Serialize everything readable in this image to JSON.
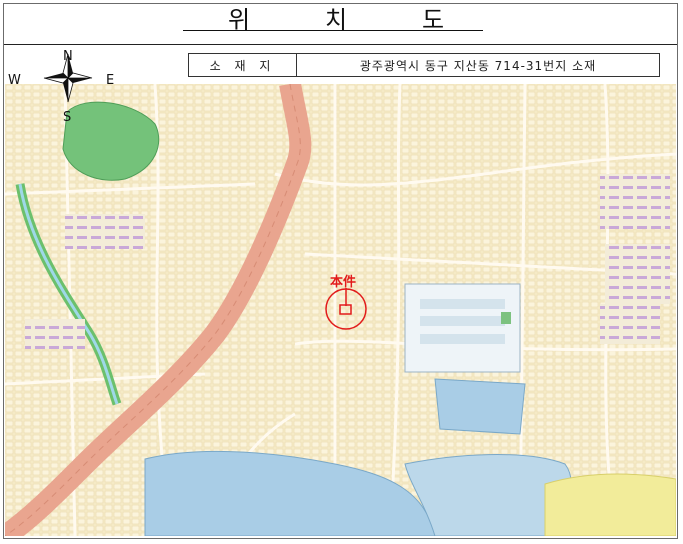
{
  "page": {
    "title_chars": [
      "위",
      "치",
      "도"
    ]
  },
  "location": {
    "label": "소 재 지",
    "address": "광주광역시 동구 지산동 714-31번지 소재"
  },
  "compass": {
    "north": "N",
    "south": "S",
    "east": "E",
    "west": "W"
  },
  "marker": {
    "label": "本件"
  },
  "colors": {
    "road": "#e9a58f",
    "park": "#74c27a",
    "water": "#a9cde6",
    "sand": "#f2ec9a",
    "marker": "#e21b1b",
    "map_bg": "#f6ecc9"
  }
}
